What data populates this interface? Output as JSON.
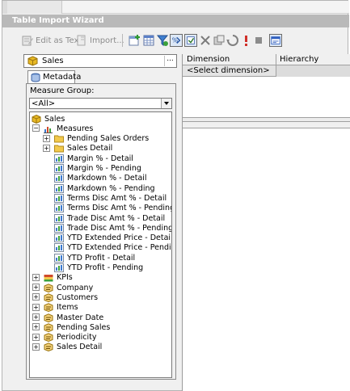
{
  "window": {
    "title": "Table Import Wizard"
  },
  "toolbar": {
    "edit_as_text": "Edit as Text",
    "import": "Import...",
    "icons": [
      "add-icon",
      "table-icon",
      "filter-icon",
      "show-empty-icon",
      "auto-execute-icon",
      "delete-icon",
      "clear-icon",
      "refresh-icon",
      "execute-icon",
      "cancel-icon",
      "design-mode-icon"
    ]
  },
  "cube": {
    "name": "Sales",
    "browse_label": "..."
  },
  "metadata_tab": {
    "label": "Metadata"
  },
  "measure_group": {
    "label": "Measure Group:",
    "value": "<All>"
  },
  "tree": {
    "root": "Sales",
    "measures_label": "Measures",
    "measure_folders": [
      "Pending Sales Orders",
      "Sales Detail"
    ],
    "measures": [
      "Margin % - Detail",
      "Margin % - Pending",
      "Markdown % - Detail",
      "Markdown % - Pending",
      "Terms Disc Amt % - Detail",
      "Terms Disc Amt % - Pending",
      "Trade Disc Amt % - Detail",
      "Trade Disc Amt % - Pending",
      "YTD Extended Price - Detail",
      "YTD Extended Price - Pending",
      "YTD Profit - Detail",
      "YTD Profit - Pending"
    ],
    "kpis_label": "KPIs",
    "dimensions": [
      "Company",
      "Customers",
      "Items",
      "Master Date",
      "Pending Sales",
      "Periodicity",
      "Sales Detail"
    ]
  },
  "filter_grid": {
    "columns": [
      "Dimension",
      "Hierarchy"
    ],
    "placeholder_row": "<Select dimension>"
  },
  "colors": {
    "title_bar": "#b9b9b9",
    "cube_gold": "#e8b923",
    "folder_yellow": "#f2c94c"
  }
}
